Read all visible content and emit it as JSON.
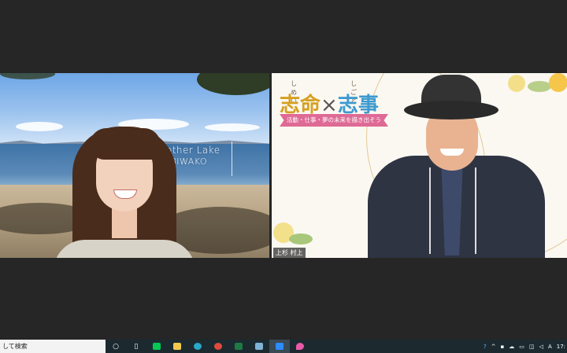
{
  "left_participant": {
    "background_caption_line1": "Mother Lake",
    "background_caption_line2": "BIWAKO"
  },
  "right_participant": {
    "title_ruby_1": "しめい",
    "title_ruby_2": "しごと",
    "title_part1": "志命",
    "title_cross": "×",
    "title_part2": "志事",
    "ribbon_text": "活動・仕事・夢の未来を描き出そう",
    "name_label": "上杉 村上"
  },
  "taskbar": {
    "search_placeholder": "して検索",
    "clock": "17:",
    "ime_label": "A",
    "icons": [
      "search-circle-icon",
      "task-view-icon",
      "line-app-icon",
      "file-explorer-icon",
      "edge-icon",
      "chrome-icon",
      "excel-icon",
      "notepad-icon",
      "zoom-icon",
      "droplet-app-icon"
    ],
    "colors": {
      "line": "#06c755",
      "explorer": "#f2c94c",
      "edge": "#2aa7c9",
      "chrome": "#e04a3c",
      "excel": "#1f7a44",
      "zoom": "#2d8cff",
      "droplet": "#e85aa8"
    }
  }
}
